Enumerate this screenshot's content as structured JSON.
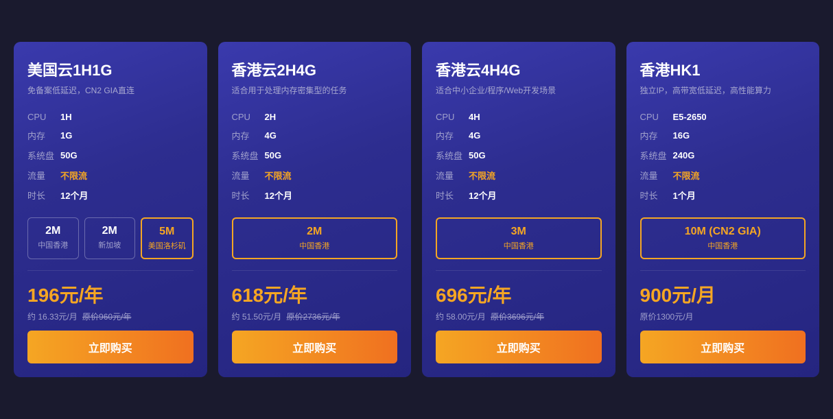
{
  "cards": [
    {
      "id": "card-1",
      "title": "美国云1H1G",
      "subtitle": "免备案低延迟，CN2 GIA直连",
      "specs": [
        {
          "label": "CPU",
          "value": "1H",
          "highlight": false
        },
        {
          "label": "内存",
          "value": "1G",
          "highlight": false
        },
        {
          "label": "系统盘",
          "value": "50G",
          "highlight": false
        },
        {
          "label": "流量",
          "value": "不限流",
          "highlight": true
        },
        {
          "label": "时长",
          "value": "12个月",
          "highlight": false
        }
      ],
      "bandwidth": [
        {
          "speed": "2M",
          "location": "中国香港",
          "selected": false
        },
        {
          "speed": "2M",
          "location": "新加坡",
          "selected": false
        },
        {
          "speed": "5M",
          "location": "美国洛杉矶",
          "selected": true
        }
      ],
      "price_main": "196元/年",
      "price_sub": "约 16.33元/月",
      "price_original": "原价960元/年",
      "buy_label": "立即购买"
    },
    {
      "id": "card-2",
      "title": "香港云2H4G",
      "subtitle": "适合用于处理内存密集型的任务",
      "specs": [
        {
          "label": "CPU",
          "value": "2H",
          "highlight": false
        },
        {
          "label": "内存",
          "value": "4G",
          "highlight": false
        },
        {
          "label": "系统盘",
          "value": "50G",
          "highlight": false
        },
        {
          "label": "流量",
          "value": "不限流",
          "highlight": true
        },
        {
          "label": "时长",
          "value": "12个月",
          "highlight": false
        }
      ],
      "bandwidth": [
        {
          "speed": "2M",
          "location": "中国香港",
          "selected": true
        }
      ],
      "price_main": "618元/年",
      "price_sub": "约 51.50元/月",
      "price_original": "原价2736元/年",
      "buy_label": "立即购买"
    },
    {
      "id": "card-3",
      "title": "香港云4H4G",
      "subtitle": "适合中小企业/程序/Web开发场景",
      "specs": [
        {
          "label": "CPU",
          "value": "4H",
          "highlight": false
        },
        {
          "label": "内存",
          "value": "4G",
          "highlight": false
        },
        {
          "label": "系统盘",
          "value": "50G",
          "highlight": false
        },
        {
          "label": "流量",
          "value": "不限流",
          "highlight": true
        },
        {
          "label": "时长",
          "value": "12个月",
          "highlight": false
        }
      ],
      "bandwidth": [
        {
          "speed": "3M",
          "location": "中国香港",
          "selected": true
        }
      ],
      "price_main": "696元/年",
      "price_sub": "约 58.00元/月",
      "price_original": "原价3696元/年",
      "buy_label": "立即购买"
    },
    {
      "id": "card-4",
      "title": "香港HK1",
      "subtitle": "独立IP，高带宽低延迟，高性能算力",
      "specs": [
        {
          "label": "CPU",
          "value": "E5-2650",
          "highlight": false
        },
        {
          "label": "内存",
          "value": "16G",
          "highlight": false
        },
        {
          "label": "系统盘",
          "value": "240G",
          "highlight": false
        },
        {
          "label": "流量",
          "value": "不限流",
          "highlight": true
        },
        {
          "label": "时长",
          "value": "1个月",
          "highlight": false
        }
      ],
      "bandwidth": [
        {
          "speed": "10M (CN2 GIA)",
          "location": "中国香港",
          "selected": true
        }
      ],
      "price_main": "900元/月",
      "price_sub": "",
      "price_original": "原价1300元/月",
      "buy_label": "立即购买"
    }
  ]
}
